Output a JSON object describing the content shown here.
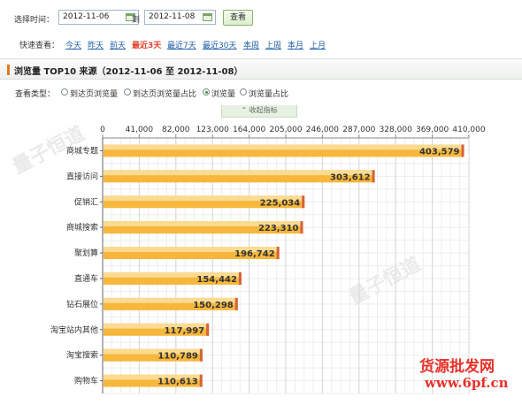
{
  "filter": {
    "select_time_label": "选择时间：",
    "start_date": "2012-11-06",
    "to_label": "到",
    "end_date": "2012-11-08",
    "view_button": "查看"
  },
  "quick": {
    "label": "快速查看：",
    "links": [
      "今天",
      "昨天",
      "前天",
      "最近3天",
      "最近7天",
      "最近30天",
      "本周",
      "上周",
      "本月",
      "上月"
    ],
    "active_index": 3
  },
  "section": {
    "title": "浏览量 TOP10 来源（2012-11-06 至 2012-11-08）"
  },
  "view_type": {
    "label": "查看类型：",
    "options": [
      "到达页浏览量",
      "到达页浏览量占比",
      "浏览量",
      "浏览量占比"
    ],
    "selected_index": 2
  },
  "collapse_label": "收起指标",
  "chart_data": {
    "type": "bar",
    "orientation": "horizontal",
    "categories": [
      "商城专题",
      "直接访问",
      "促销汇",
      "商城搜索",
      "聚划算",
      "直通车",
      "钻石展位",
      "淘宝站内其他",
      "淘宝搜索",
      "购物车"
    ],
    "values": [
      403579,
      303612,
      225034,
      223310,
      196742,
      154442,
      150298,
      117997,
      110789,
      110613
    ],
    "value_labels": [
      "403,579",
      "303,612",
      "225,034",
      "223,310",
      "196,742",
      "154,442",
      "150,298",
      "117,997",
      "110,789",
      "110,613"
    ],
    "xlim": [
      0,
      410000
    ],
    "xticks": [
      0,
      41000,
      82000,
      123000,
      164000,
      205000,
      246000,
      287000,
      328000,
      369000,
      410000
    ],
    "xtick_labels": [
      "0",
      "41,000",
      "82,000",
      "123,000",
      "164,000",
      "205,000",
      "246,000",
      "287,000",
      "328,000",
      "369,000",
      "410,000"
    ],
    "grid": true,
    "bar_color": "#f6b73c"
  },
  "watermarks": {
    "site_cn": "货源批发网",
    "site_url": "www.6pf.cn"
  }
}
